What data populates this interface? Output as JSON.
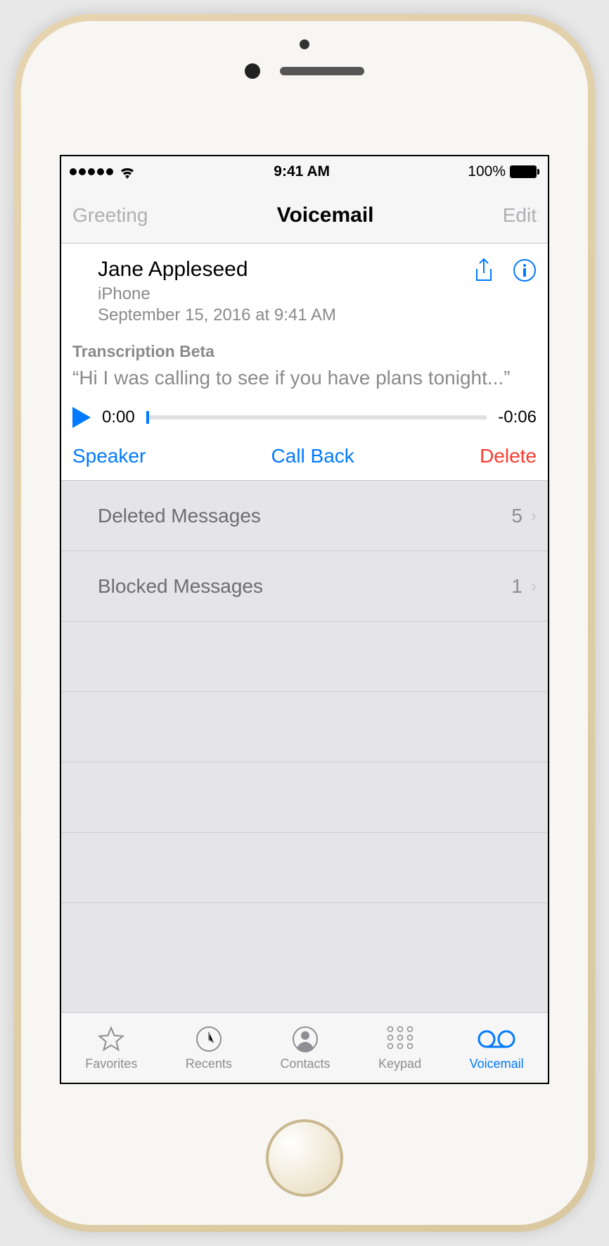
{
  "status": {
    "time": "9:41 AM",
    "battery": "100%"
  },
  "nav": {
    "left": "Greeting",
    "title": "Voicemail",
    "right": "Edit"
  },
  "voicemail": {
    "name": "Jane Appleseed",
    "source": "iPhone",
    "timestamp": "September 15, 2016 at 9:41 AM",
    "trans_label": "Transcription Beta",
    "trans_text": "“Hi I was calling to see if you have plans tonight...”",
    "elapsed": "0:00",
    "remaining": "-0:06",
    "actions": {
      "speaker": "Speaker",
      "callback": "Call Back",
      "delete": "Delete"
    }
  },
  "rows": {
    "deleted": {
      "label": "Deleted Messages",
      "count": "5"
    },
    "blocked": {
      "label": "Blocked Messages",
      "count": "1"
    }
  },
  "tabs": {
    "favorites": "Favorites",
    "recents": "Recents",
    "contacts": "Contacts",
    "keypad": "Keypad",
    "voicemail": "Voicemail"
  }
}
